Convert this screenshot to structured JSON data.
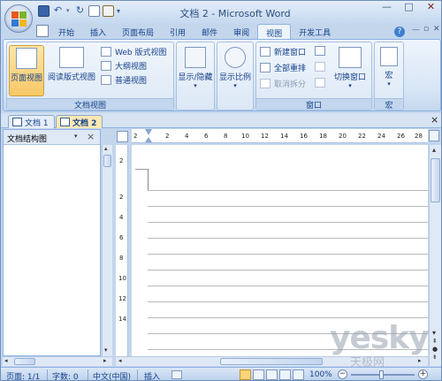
{
  "window": {
    "title": "文档 2 - Microsoft Word"
  },
  "ribbon_tabs": [
    "开始",
    "插入",
    "页面布局",
    "引用",
    "邮件",
    "审阅",
    "视图",
    "开发工具"
  ],
  "active_tab": "视图",
  "groups": {
    "doc_views": {
      "label": "文档视图",
      "page_view": "页面视图",
      "reading_view": "阅读版式视图",
      "web_view": "Web 版式视图",
      "outline_view": "大纲视图",
      "draft_view": "普通视图"
    },
    "show_hide": {
      "label": "显示/隐藏"
    },
    "zoom": {
      "label": "显示比例"
    },
    "window": {
      "label": "窗口",
      "new_window": "新建窗口",
      "arrange_all": "全部重排",
      "remove_split": "取消拆分",
      "switch_windows": "切换窗口"
    },
    "macros": {
      "label": "宏",
      "button": "宏"
    }
  },
  "doc_tabs": [
    "文档 1",
    "文档 2"
  ],
  "active_doc_tab": "文档 2",
  "nav_pane": {
    "dropdown_value": "文档结构图"
  },
  "ruler_ticks": [
    "2",
    "2",
    "4",
    "6",
    "8",
    "10",
    "12",
    "14",
    "16",
    "18",
    "20",
    "22",
    "24",
    "26",
    "28"
  ],
  "vruler_ticks": [
    "2",
    "2",
    "4",
    "6",
    "8",
    "10",
    "12",
    "14"
  ],
  "statusbar": {
    "page": "页面: 1/1",
    "words": "字数: 0",
    "language": "中文(中国)",
    "insert_mode": "插入",
    "zoom": "100%"
  },
  "watermark": {
    "text": "yesky",
    "sub": "天极网"
  },
  "colors": {
    "accent": "#15428b",
    "ribbon_bg": "#d8e6f6",
    "selected": "#f8c866"
  }
}
